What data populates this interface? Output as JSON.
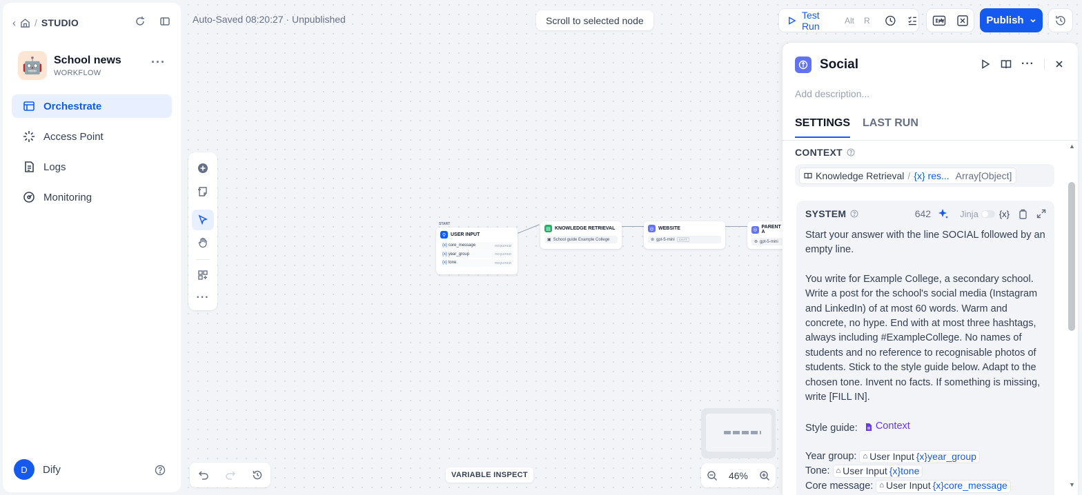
{
  "breadcrumb": {
    "section": "STUDIO"
  },
  "app": {
    "name": "School news",
    "type": "WORKFLOW",
    "emoji": "🤖"
  },
  "nav": [
    {
      "label": "Orchestrate",
      "active": true
    },
    {
      "label": "Access Point"
    },
    {
      "label": "Logs"
    },
    {
      "label": "Monitoring"
    }
  ],
  "user": {
    "initial": "D",
    "name": "Dify"
  },
  "header": {
    "autosave": "Auto-Saved 08:20:27 · Unpublished",
    "scroll_to_node": "Scroll to selected node",
    "test_run": "Test Run",
    "shortcut_1": "Alt",
    "shortcut_2": "R",
    "publish": "Publish"
  },
  "canvas": {
    "start_tag": "START",
    "nodes": {
      "user_input": {
        "title": "USER INPUT",
        "vars": [
          "core_message",
          "year_group",
          "tone"
        ],
        "req": "REQUIRED"
      },
      "knowledge": {
        "title": "KNOWLEDGE RETRIEVAL",
        "chip": "School guide Example College"
      },
      "website": {
        "title": "WEBSITE",
        "model": "gpt-5-mini",
        "model_tag": "CHAT"
      },
      "parent": {
        "title": "PARENT A",
        "model": "gpt-5-mini"
      }
    },
    "var_prefix": "{x}",
    "variable_inspect": "VARIABLE INSPECT",
    "zoom": "46%"
  },
  "panel": {
    "title": "Social",
    "description_placeholder": "Add description...",
    "tabs": [
      "SETTINGS",
      "LAST RUN"
    ],
    "context_label": "CONTEXT",
    "context": {
      "node": "Knowledge Retrieval",
      "sep": "/",
      "var": "{x} res...",
      "type": "Array[Object]"
    },
    "system": {
      "label": "SYSTEM",
      "count": "642",
      "jinja": "Jinja",
      "var_icon": "{x}",
      "p1": "Start your answer with the line SOCIAL followed by an empty line.",
      "p2": "You write for Example College, a secondary school. Write a post for the school's social media (Instagram and LinkedIn) of at most 60 words. Warm and concrete, no hype. End with at most three hashtags, always including #ExampleCollege. No names of students and no reference to recognisable photos of students. Stick to the style guide below. Adapt to the chosen tone. Invent no facts. If something is missing, write [FILL IN].",
      "style_guide_label": "Style guide:",
      "style_guide_ref": "Context",
      "lines": [
        {
          "label": "Year group:",
          "node": "User Input",
          "var": "{x}year_group"
        },
        {
          "label": "Tone:",
          "node": "User Input",
          "var": "{x}tone"
        },
        {
          "label": "Core message:",
          "node": "User Input",
          "var": "{x}core_message"
        }
      ]
    }
  },
  "colors": {
    "accent": "#155aef",
    "node_llm": "#6172f3",
    "node_knowledge": "#16b364"
  }
}
